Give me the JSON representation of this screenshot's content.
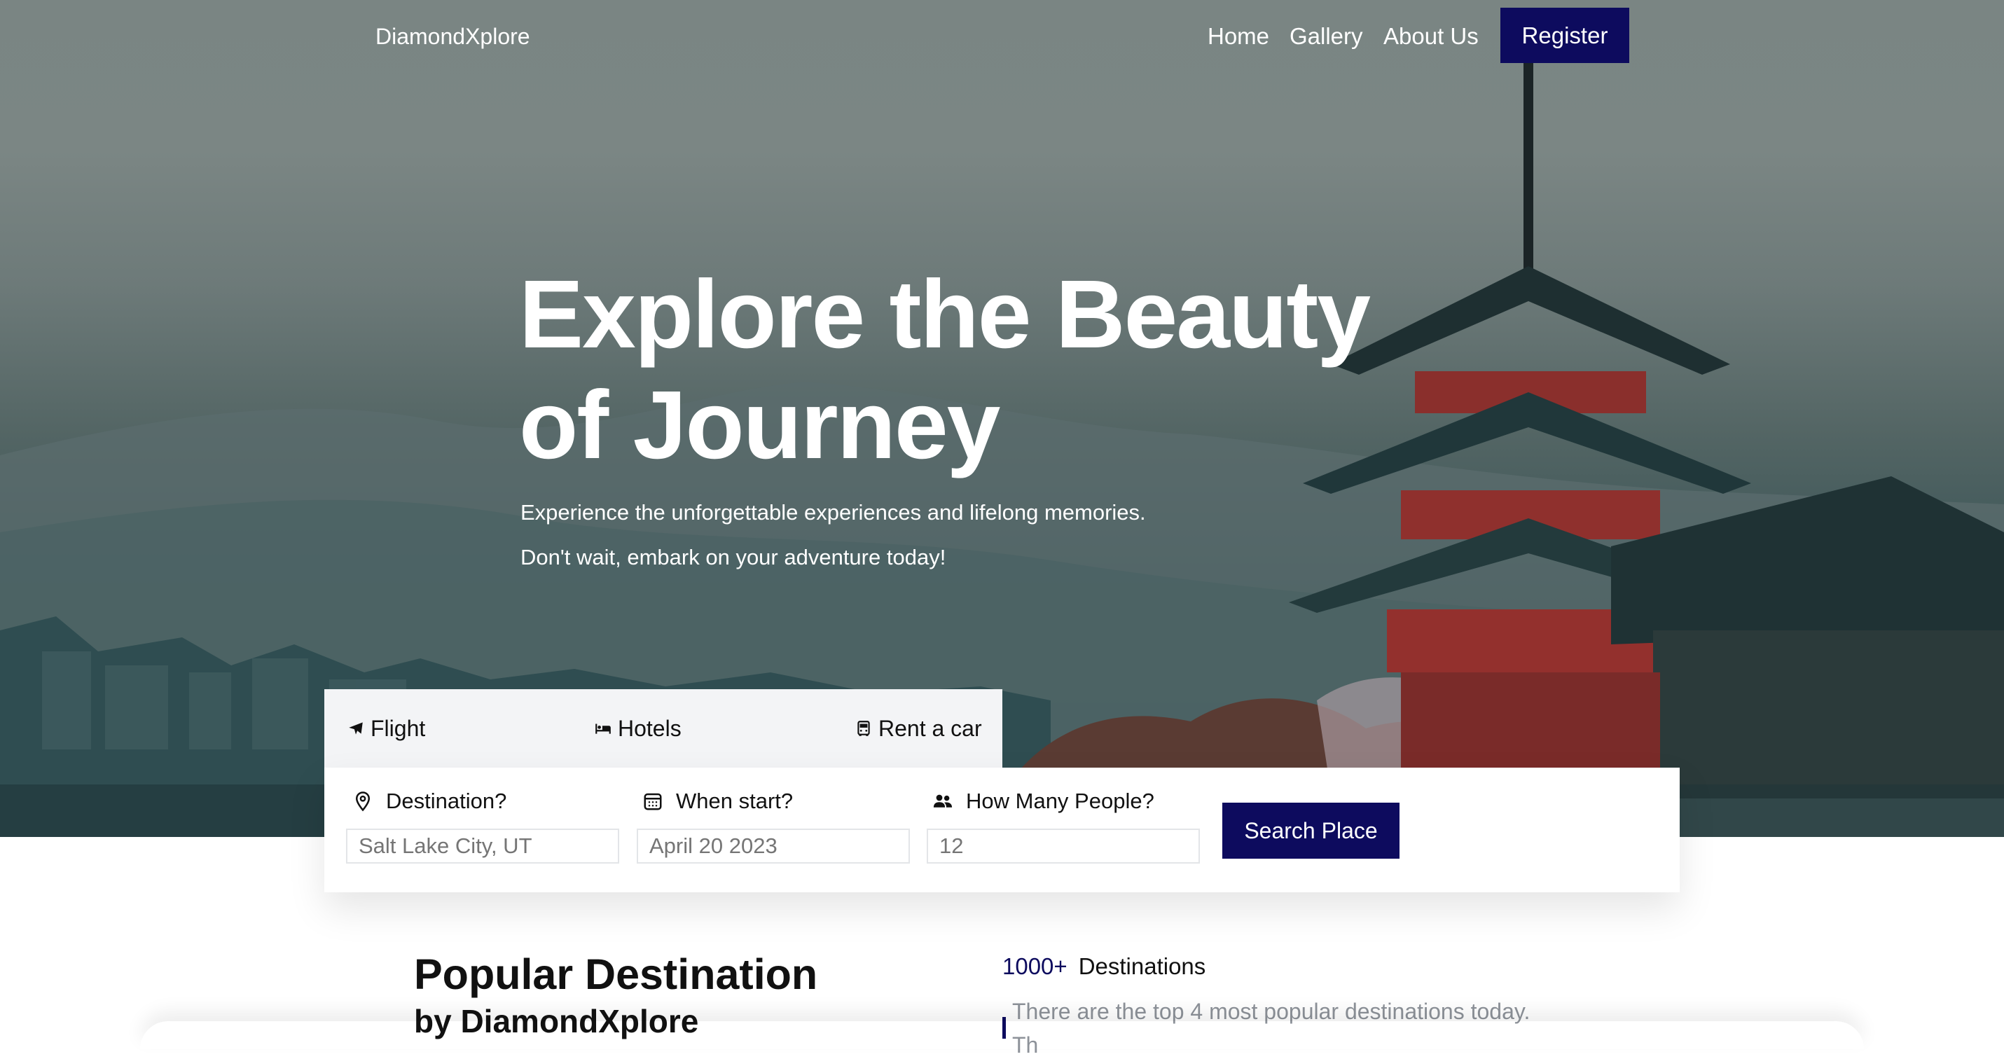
{
  "nav": {
    "brand": "DiamondXplore",
    "links": [
      "Home",
      "Gallery",
      "About Us"
    ],
    "register": "Register"
  },
  "hero": {
    "title_line1": "Explore the Beauty",
    "title_line2": "of Journey",
    "subtitle_line1": "Experience the unforgettable experiences and lifelong memories.",
    "subtitle_line2": "Don't wait, embark on your adventure today!"
  },
  "search": {
    "tabs": [
      {
        "label": "Flight",
        "icon": "plane-icon"
      },
      {
        "label": "Hotels",
        "icon": "bed-icon"
      },
      {
        "label": "Rent a car",
        "icon": "car-icon"
      }
    ],
    "fields": [
      {
        "label": "Destination?",
        "icon": "map-pin-icon",
        "placeholder": "Salt Lake City, UT"
      },
      {
        "label": "When start?",
        "icon": "calendar-icon",
        "placeholder": "April 20 2023"
      },
      {
        "label": "How Many People?",
        "icon": "people-icon",
        "placeholder": "12"
      }
    ],
    "button": "Search Place"
  },
  "popular": {
    "title": "Popular Destination",
    "subtitle": "by DiamondXplore",
    "stat_number": "1000+",
    "stat_label": "Destinations",
    "description": "There are the top 4 most popular destinations today.",
    "description_cut": "Th"
  },
  "colors": {
    "accent": "#0d0b5e",
    "muted_text": "#8d9299"
  }
}
